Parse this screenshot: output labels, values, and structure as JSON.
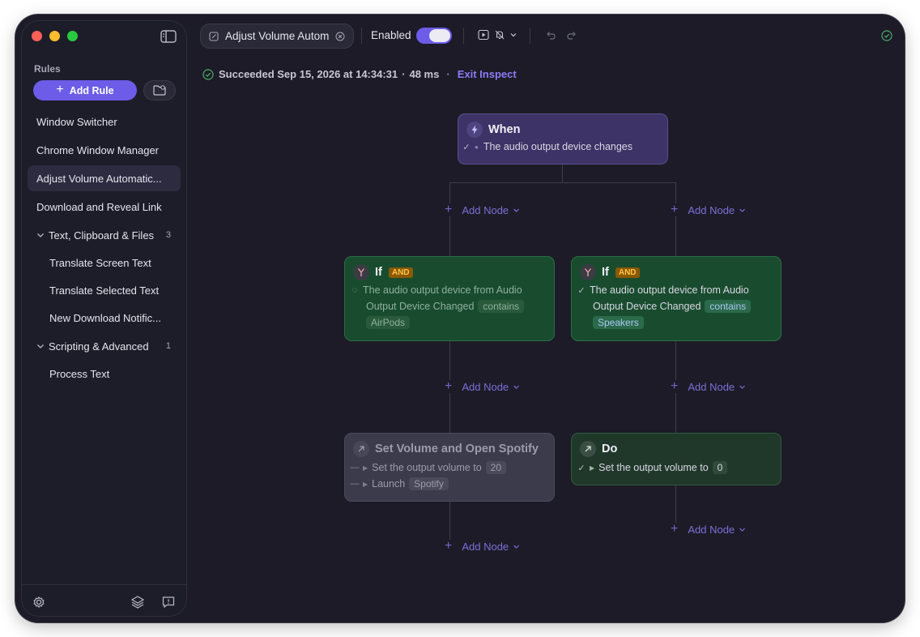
{
  "sidebar": {
    "section_label": "Rules",
    "add_rule_label": "Add Rule",
    "items": [
      {
        "label": "Window Switcher"
      },
      {
        "label": "Chrome Window Manager"
      },
      {
        "label": "Adjust Volume Automatic..."
      },
      {
        "label": "Download and Reveal Link"
      }
    ],
    "groups": [
      {
        "label": "Text, Clipboard & Files",
        "count": "3",
        "items": [
          "Translate Screen Text",
          "Translate Selected Text",
          "New Download Notific..."
        ]
      },
      {
        "label": "Scripting & Advanced",
        "count": "1",
        "items": [
          "Process Text"
        ]
      }
    ]
  },
  "toolbar": {
    "tab_title": "Adjust Volume Autom",
    "enabled_label": "Enabled",
    "enabled": true
  },
  "status": {
    "text": "Succeeded Sep 15, 2026 at 14:34:31",
    "duration": "48 ms",
    "separator": "·",
    "exit_label": "Exit Inspect"
  },
  "flow": {
    "add_node_label": "Add Node",
    "when": {
      "title": "When",
      "trigger": "The audio output device changes"
    },
    "if_left": {
      "title": "If",
      "badge": "AND",
      "line1": "The audio output device from Audio",
      "line2": "Output Device Changed",
      "operator": "contains",
      "value": "AirPods"
    },
    "if_right": {
      "title": "If",
      "badge": "AND",
      "line1": "The audio output device from Audio",
      "line2": "Output Device Changed",
      "operator": "contains",
      "value": "Speakers"
    },
    "action_left": {
      "title": "Set Volume and Open Spotify",
      "step1": "Set the output volume to",
      "step1_value": "20",
      "step2": "Launch",
      "step2_value": "Spotify"
    },
    "action_right": {
      "title": "Do",
      "step1": "Set the output volume to",
      "step1_value": "0"
    }
  },
  "colors": {
    "accent": "#6c5ce7",
    "when_node": "#3d3366",
    "if_node": "#194c2f",
    "skipped_node": "#3b3b4b",
    "success": "#4caf6a"
  }
}
